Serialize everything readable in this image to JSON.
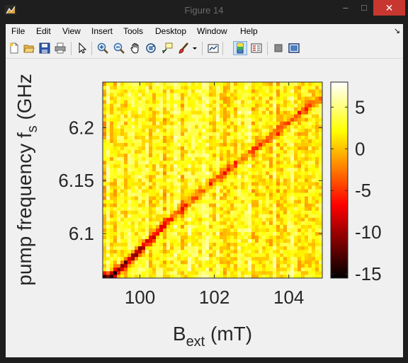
{
  "window": {
    "title": "Figure 14",
    "minimize_label": "–",
    "maximize_label": "□",
    "close_label": "✕"
  },
  "menu": {
    "items": [
      "File",
      "Edit",
      "View",
      "Insert",
      "Tools",
      "Desktop",
      "Window",
      "Help"
    ]
  },
  "toolbar": {
    "icons": [
      "new-figure-icon",
      "open-file-icon",
      "save-icon",
      "print-icon",
      "pointer-icon",
      "zoom-in-icon",
      "zoom-out-icon",
      "pan-hand-icon",
      "rotate-3d-icon",
      "data-cursor-icon",
      "brush-icon",
      "brush-dropdown-icon",
      "link-plot-icon",
      "colorbar-icon",
      "legend-icon",
      "hide-plot-tools-icon",
      "show-plot-tools-icon"
    ]
  },
  "chart_data": {
    "type": "heatmap",
    "xlabel": "B",
    "xlabel_sub": "ext",
    "xlabel_unit": " (mT)",
    "ylabel": "pump frequency f",
    "ylabel_sub": "s",
    "ylabel_unit": " (GHz",
    "x_range": [
      99.0,
      104.9
    ],
    "y_range": [
      6.058,
      6.243
    ],
    "x_ticks": [
      100,
      102,
      104
    ],
    "x_tick_labels": [
      "100",
      "102",
      "104"
    ],
    "y_ticks": [
      6.1,
      6.15,
      6.2
    ],
    "y_tick_labels": [
      "6.1",
      "6.15",
      "6.2"
    ],
    "color_range": [
      -15.5,
      8
    ],
    "colorbar_ticks": [
      5,
      0,
      -5,
      -10,
      -15
    ],
    "colorbar_tick_labels": [
      "5",
      "0",
      "-5",
      "-10",
      "-15"
    ],
    "colormap": "hot",
    "resonance_line": {
      "x": [
        99.2,
        100.0,
        101.0,
        102.0,
        103.0,
        104.0,
        104.8
      ],
      "y": [
        6.058,
        6.085,
        6.12,
        6.15,
        6.178,
        6.205,
        6.228
      ]
    },
    "grid": false
  }
}
